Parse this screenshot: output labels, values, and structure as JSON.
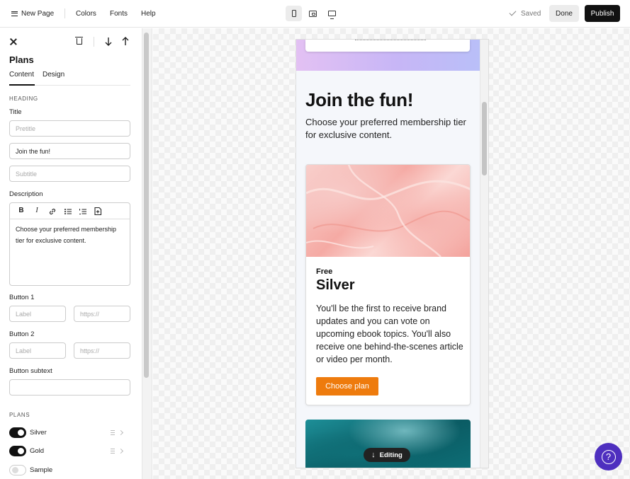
{
  "topbar": {
    "menu_label": "New Page",
    "colors_label": "Colors",
    "fonts_label": "Fonts",
    "help_label": "Help",
    "saved_label": "Saved",
    "done_label": "Done",
    "publish_label": "Publish",
    "devices": [
      "phone",
      "tablet",
      "desktop"
    ],
    "active_device": "phone"
  },
  "sidebar": {
    "title": "Plans",
    "tabs": [
      {
        "label": "Content",
        "active": true
      },
      {
        "label": "Design",
        "active": false
      }
    ],
    "heading_section": "HEADING",
    "title_label": "Title",
    "pretitle_placeholder": "Pretitle",
    "title_value": "Join the fun!",
    "subtitle_placeholder": "Subtitle",
    "description_label": "Description",
    "description_value": "Choose your preferred membership tier for exclusive content.",
    "toolbar_buttons": [
      "B",
      "I"
    ],
    "button1_label": "Button 1",
    "button2_label": "Button 2",
    "button_label_placeholder": "Label",
    "button_url_placeholder": "https://",
    "button_subtext_label": "Button subtext",
    "plans_section": "PLANS",
    "plans": [
      {
        "name": "Silver",
        "enabled": true
      },
      {
        "name": "Gold",
        "enabled": true
      },
      {
        "name": "Sample",
        "enabled": false
      }
    ]
  },
  "preview": {
    "heading": "Join the fun!",
    "description": "Choose your preferred membership tier for exclusive content.",
    "plan": {
      "price": "Free",
      "title": "Silver",
      "description": "You'll be the first to receive brand updates and you can vote on upcoming ebook topics. You'll also receive one behind-the-scenes article or video per month.",
      "button_label": "Choose plan",
      "button_color": "#ee7b0d"
    },
    "editing_label": "Editing"
  },
  "help_button": {
    "icon": "question-icon",
    "color": "#4e2fbf"
  }
}
